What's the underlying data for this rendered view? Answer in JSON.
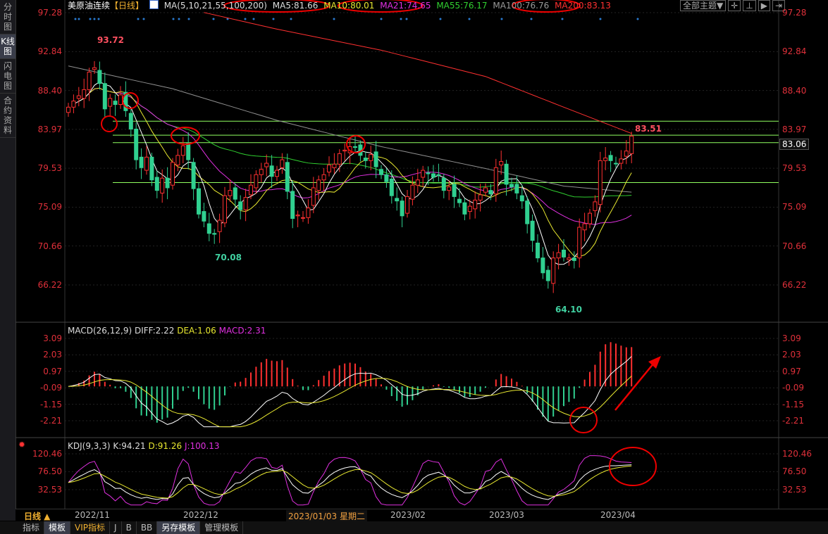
{
  "sidebar": {
    "items": [
      {
        "label": "分时图"
      },
      {
        "label": "K线图",
        "active": true
      },
      {
        "label": "闪电图"
      },
      {
        "label": "合约资料"
      }
    ]
  },
  "header": {
    "instrument": "美原油连续",
    "period": "【日线】",
    "ma_params": "MA(5,10,21,55,100,200)",
    "ma5": "MA5:81.66",
    "ma10": "MA10:80.01",
    "ma21": "MA21:74.65",
    "ma55": "MA55:76.17",
    "ma100": "MA100:76.76",
    "ma200": "MA200:83.13"
  },
  "toolbar": {
    "theme_select": "全部主题▼"
  },
  "price_axis": [
    "97.28",
    "92.84",
    "88.40",
    "83.97",
    "79.53",
    "75.09",
    "70.66",
    "66.22"
  ],
  "current_price_tag": "83.06",
  "annotations": {
    "high": "93.72",
    "low1": "70.08",
    "low2": "64.10",
    "last_high": "83.51"
  },
  "macd": {
    "title": "MACD(26,12,9)",
    "diff": "DIFF:2.22",
    "dea": "DEA:1.06",
    "macd": "MACD:2.31",
    "axis": [
      "3.09",
      "2.03",
      "0.97",
      "-0.09",
      "-1.15",
      "-2.21"
    ]
  },
  "kdj": {
    "title": "KDJ(9,3,3)",
    "k": "K:94.21",
    "d": "D:91.26",
    "j": "J:100.13",
    "axis": [
      "120.46",
      "76.50",
      "32.53"
    ]
  },
  "date_axis": {
    "period": "日线 ▲",
    "labels": [
      "2022/11",
      "2022/12",
      "2023/01/03 星期二",
      "2023/02",
      "2023/03",
      "2023/04"
    ]
  },
  "bottom_tabs": [
    "指标",
    "模板",
    "VIP指标",
    "J",
    "B",
    "BB",
    "另存模板",
    "管理模板"
  ],
  "colors": {
    "up": "#ff3030",
    "down": "#30d090",
    "ma5": "#ffffff",
    "ma10": "#e8e830",
    "ma21": "#e030e0",
    "ma55": "#30d030",
    "ma100": "#909090",
    "ma200": "#ff3030",
    "level": "#90ff60"
  },
  "chart_data": {
    "type": "candlestick",
    "ylim": [
      66.22,
      97.28
    ],
    "closes": [
      86.5,
      87.2,
      87.8,
      88.5,
      90.5,
      91.0,
      89.2,
      86.3,
      87.5,
      86.8,
      87.9,
      86.1,
      84.0,
      80.5,
      79.6,
      80.8,
      78.2,
      77.0,
      78.4,
      77.3,
      80.2,
      81.0,
      82.1,
      80.5,
      77.2,
      74.3,
      73.5,
      72.1,
      72.0,
      73.6,
      76.4,
      77.0,
      76.0,
      74.8,
      76.2,
      77.6,
      78.8,
      79.4,
      80.1,
      78.6,
      79.3,
      80.5,
      76.9,
      73.8,
      74.2,
      73.9,
      75.0,
      77.3,
      78.2,
      78.8,
      79.9,
      80.0,
      81.2,
      81.6,
      82.0,
      81.9,
      81.0,
      80.4,
      81.1,
      79.7,
      78.8,
      78.0,
      76.4,
      75.8,
      74.1,
      76.3,
      77.6,
      78.2,
      79.3,
      78.9,
      78.5,
      78.7,
      77.0,
      77.4,
      76.3,
      75.6,
      74.3,
      75.2,
      75.9,
      76.5,
      77.3,
      76.6,
      79.6,
      80.3,
      77.7,
      77.4,
      76.7,
      75.8,
      73.2,
      71.3,
      69.3,
      67.6,
      66.7,
      69.3,
      69.9,
      69.4,
      69.3,
      69.0,
      72.8,
      73.2,
      74.4,
      75.7,
      80.4,
      80.7,
      80.4,
      80.1,
      80.6,
      81.5,
      83.2
    ],
    "ma100_approx": [
      [
        0,
        91.2
      ],
      [
        20,
        88.6
      ],
      [
        40,
        85.0
      ],
      [
        60,
        82.0
      ],
      [
        80,
        79.5
      ],
      [
        95,
        77.5
      ],
      [
        108,
        76.8
      ]
    ],
    "ma200_approx": [
      [
        26,
        97.3
      ],
      [
        40,
        95.4
      ],
      [
        60,
        93.0
      ],
      [
        80,
        90.0
      ],
      [
        95,
        86.5
      ],
      [
        108,
        83.5
      ]
    ],
    "levels": [
      84.9,
      83.3,
      82.45,
      77.9
    ],
    "extremes": {
      "high": 93.72,
      "low1": 70.08,
      "low2": 64.1,
      "last_high": 83.51
    }
  }
}
